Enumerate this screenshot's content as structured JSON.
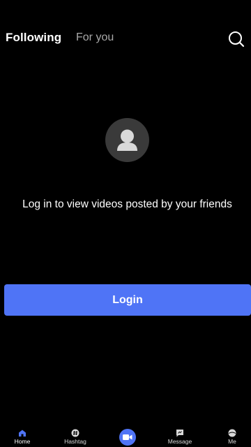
{
  "header": {
    "tabs": [
      {
        "label": "Following",
        "active": true
      },
      {
        "label": "For you",
        "active": false
      }
    ],
    "search_icon": "search-icon"
  },
  "empty_state": {
    "avatar_icon": "user-avatar-icon",
    "message": "Log in to view videos posted by your friends"
  },
  "login_button": {
    "label": "Login",
    "color": "#4f74f6"
  },
  "bottom_nav": {
    "items": [
      {
        "label": "Home",
        "icon": "home-icon",
        "active": true
      },
      {
        "label": "Hashtag",
        "icon": "hashtag-icon"
      },
      {
        "label": "",
        "icon": "video-record-icon"
      },
      {
        "label": "Message",
        "icon": "message-icon"
      },
      {
        "label": "Me",
        "icon": "profile-icon"
      }
    ]
  },
  "colors": {
    "background": "#000000",
    "accent": "#4f74f6",
    "inactive_tab": "#a9a9a9"
  }
}
